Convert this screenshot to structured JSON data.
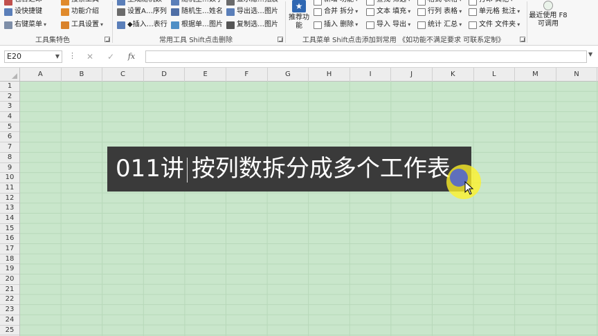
{
  "ribbon": {
    "group1": {
      "items": [
        "包含之印",
        "设快捷键",
        "右键菜单"
      ],
      "items2": [
        "搜索工具",
        "功能介绍",
        "工具设置"
      ],
      "label": "工具集特色"
    },
    "group2": {
      "items": [
        "生成随机数",
        "设置A…序列",
        "◆插入…表行"
      ],
      "items2": [
        "随机生…数字",
        "随机生…姓名",
        "根据单…图片"
      ],
      "items3": [
        "显示隐…拓展",
        "导出选…图片",
        "复制选…图片"
      ],
      "label": "常用工具 Shift点击删除"
    },
    "group3": {
      "recommend_label": "推荐功能",
      "col1": [
        "新增 功能",
        "合并 拆分",
        "插入 删除"
      ],
      "col2": [
        "查找 筛选",
        "文本 填充",
        "导入 导出"
      ],
      "col3": [
        "格式 表格",
        "行列 表格",
        "统计 汇总"
      ],
      "col4": [
        "打印 其他",
        "单元格 批注",
        "文件 文件夹"
      ],
      "label": "工具菜单 Shift点击添加到常用 《如功能不满足要求 可联系定制》"
    },
    "group4": {
      "label": "最近使用 F8 可调用"
    }
  },
  "formula_bar": {
    "name_box": "E20",
    "more_symbol": "⋮",
    "cancel_symbol": "✕",
    "enter_symbol": "✓",
    "fx_symbol": "fx",
    "formula": ""
  },
  "sheet": {
    "columns": [
      "A",
      "B",
      "C",
      "D",
      "E",
      "F",
      "G",
      "H",
      "I",
      "J",
      "K",
      "L",
      "M",
      "N"
    ],
    "rows": [
      "1",
      "2",
      "3",
      "4",
      "5",
      "6",
      "7",
      "8",
      "9",
      "10",
      "11",
      "12",
      "13",
      "14",
      "15",
      "16",
      "17",
      "18",
      "19",
      "20",
      "21",
      "22",
      "23",
      "24",
      "25"
    ]
  },
  "overlay": {
    "caption_number": "011讲",
    "caption_text": "按列数拆分成多个工作表"
  },
  "colors": {
    "sheet_bg": "#c9e6cb",
    "caption_bg": "#3a3a3a",
    "highlight": "#fff228",
    "accent": "#2f67b2"
  }
}
